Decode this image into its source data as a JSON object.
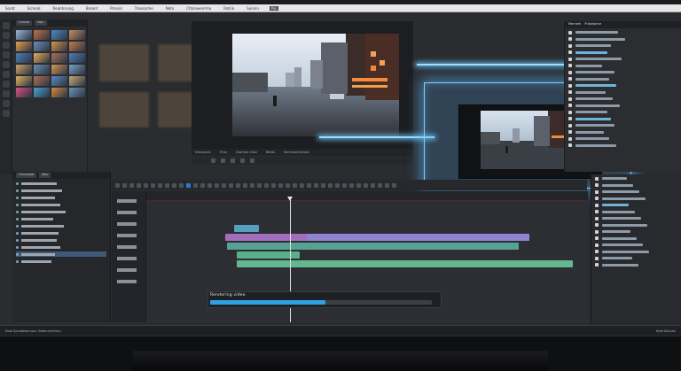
{
  "menubar": {
    "items": [
      "Sorat",
      "Screnal",
      "Reantorung",
      "Breant",
      "Pronial",
      "Transarme",
      "Neta",
      "Chtonwenrma",
      "Ratria",
      "Sonnin",
      "Pal"
    ],
    "active_index": 10
  },
  "media_bin": {
    "tabs": [
      "Curcas",
      "Inpn"
    ],
    "thumb_colors": [
      "#9bb7d9",
      "#c46f47",
      "#4f8ac6",
      "#c98c62",
      "#e3a04e",
      "#6c8fc0",
      "#d8944a",
      "#c77a4c",
      "#4e7fb5",
      "#e8ad5b",
      "#aa7058",
      "#4f7db7",
      "#caa36b",
      "#6f8db2",
      "#d99657",
      "#7da0c6",
      "#e2b160",
      "#b07152",
      "#5b8cc2",
      "#c8a879",
      "#d9527f",
      "#4aa1cf",
      "#d08b3f",
      "#6a95b8"
    ]
  },
  "viewer": {
    "bar_labels": [
      "Vtensnres",
      "Trme",
      "Drarmle chon",
      "Bletts",
      "Semvlantrutions"
    ]
  },
  "inspector": {
    "tabs": [
      "Mernem",
      "Prlbwtame"
    ]
  },
  "tracks_panel": {
    "tabs": [
      "Chnrumal",
      "Volv"
    ]
  },
  "timeline": {
    "clips": [
      {
        "track": 1,
        "start": 0.198,
        "end": 0.256,
        "color": "#5db3d8"
      },
      {
        "track": 2,
        "start": 0.178,
        "end": 0.868,
        "color": "#b77ad6"
      },
      {
        "track": 2,
        "start": 0.364,
        "end": 0.868,
        "color": "#8e87d2"
      },
      {
        "track": 3,
        "start": 0.182,
        "end": 0.843,
        "color": "#5fb6a3"
      },
      {
        "track": 4,
        "start": 0.204,
        "end": 0.348,
        "color": "#62c59a"
      },
      {
        "track": 5,
        "start": 0.204,
        "end": 0.966,
        "color": "#6ecf9f"
      }
    ]
  },
  "render": {
    "label": "Rendering video",
    "progress": 0.52
  },
  "statusbar": {
    "left": "Dval Sctudawnruou l Sebrnnnrchicn",
    "right": "Hodl Zanvan"
  }
}
